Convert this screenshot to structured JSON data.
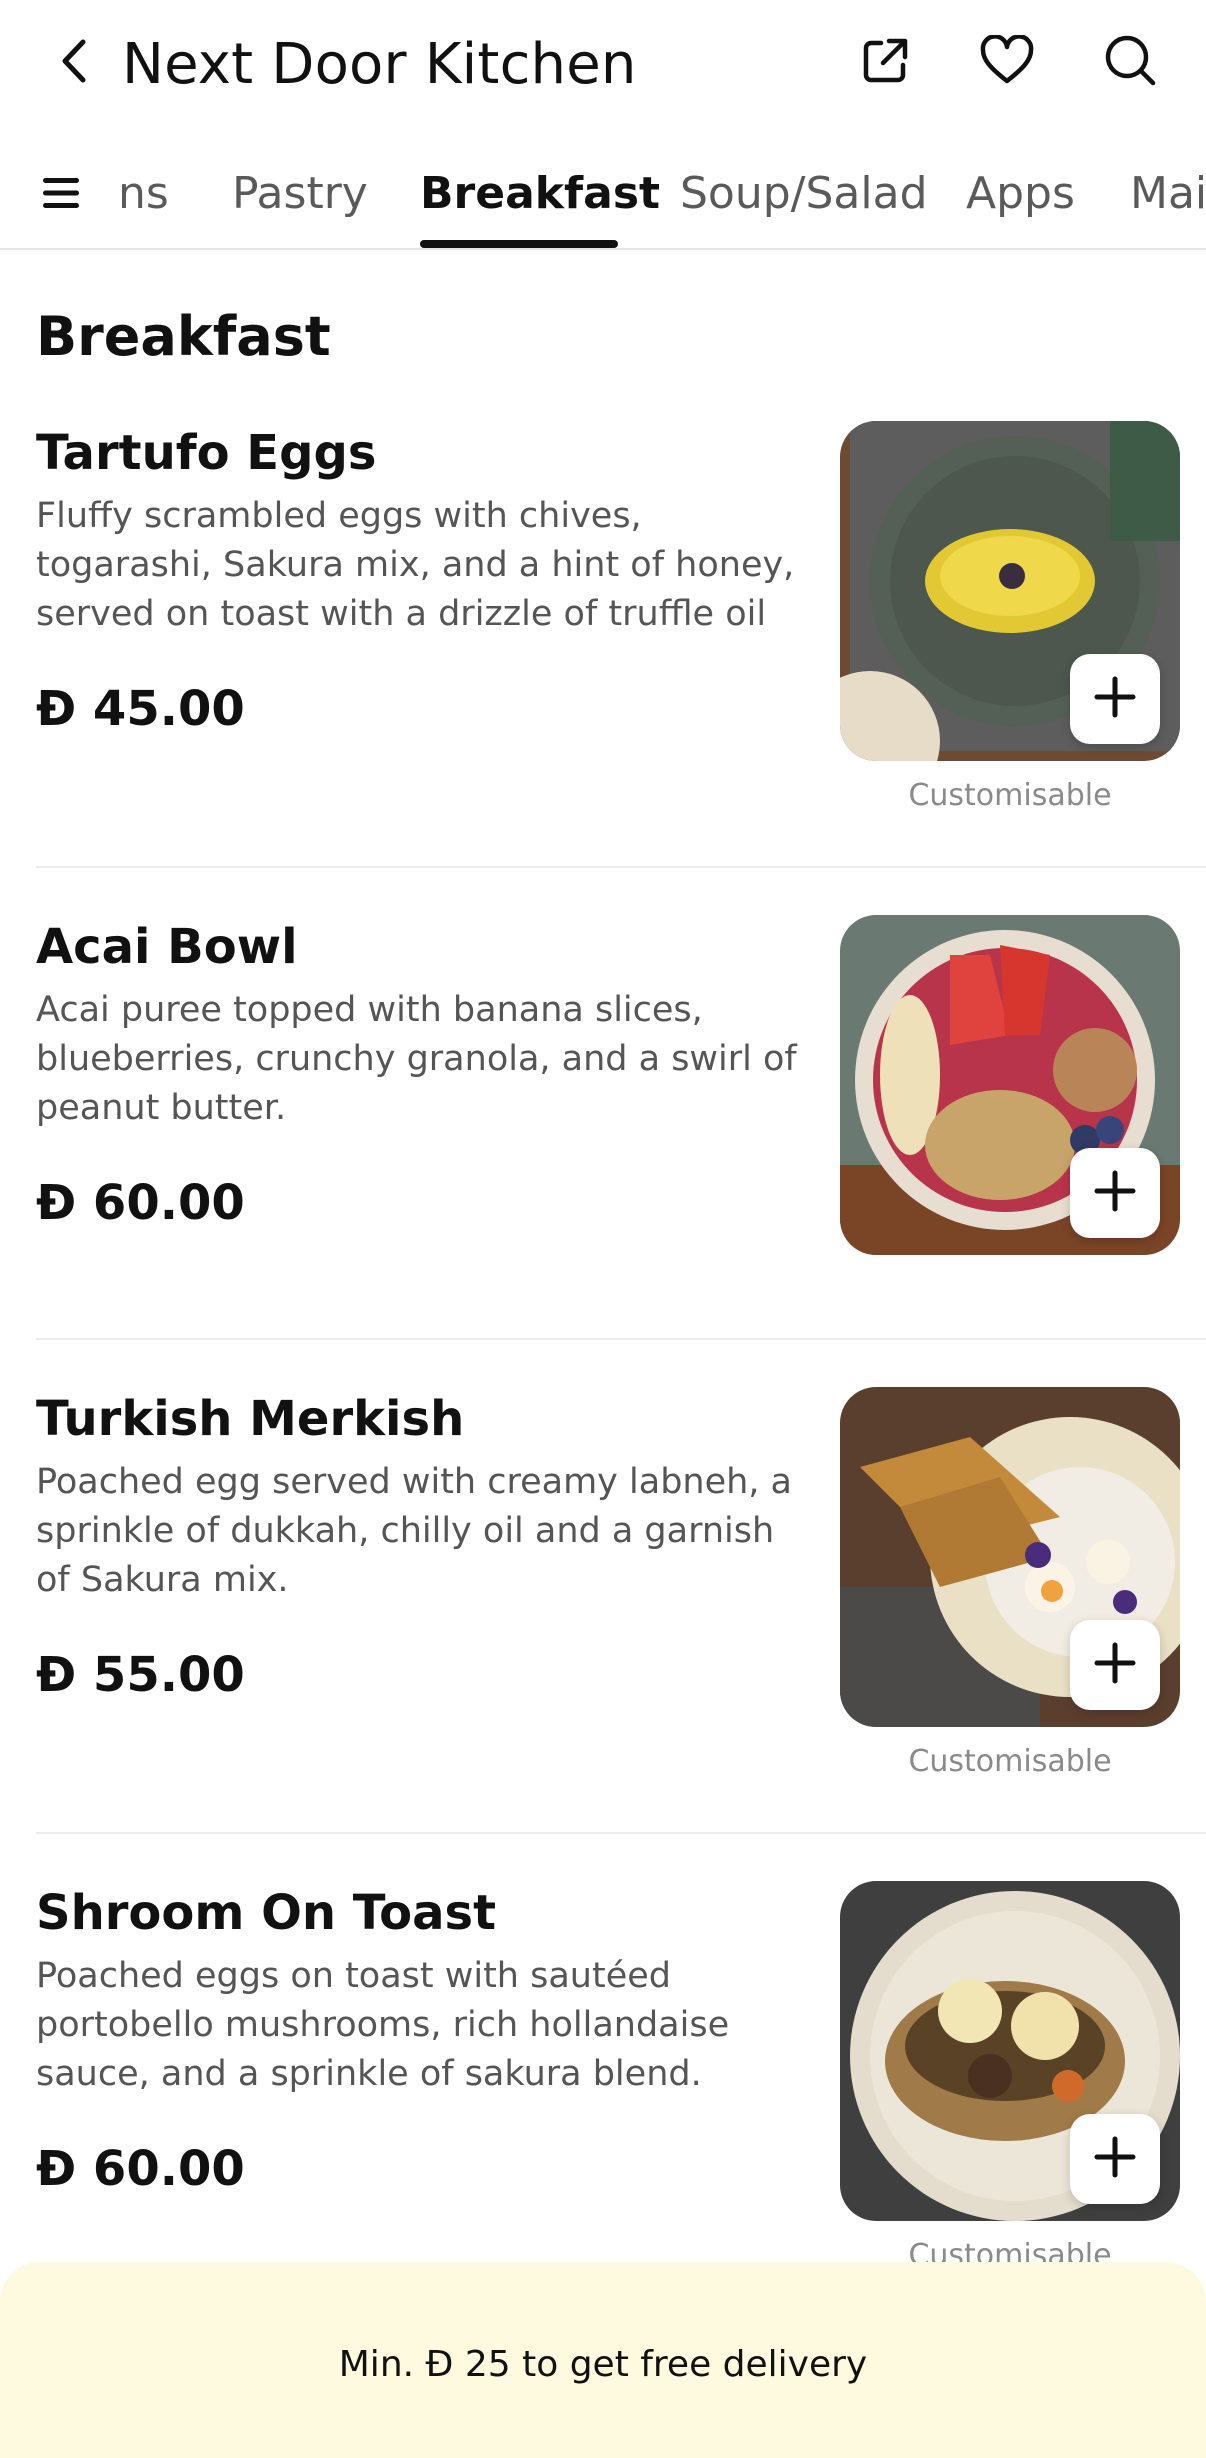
{
  "header": {
    "title": "Next Door Kitchen",
    "icons": [
      "back-arrow-icon",
      "share-icon",
      "heart-icon",
      "search-icon"
    ]
  },
  "tabs": [
    {
      "label": "ns"
    },
    {
      "label": "Pastry"
    },
    {
      "label": "Breakfast",
      "active": true
    },
    {
      "label": "Soup/Salad"
    },
    {
      "label": "Apps"
    },
    {
      "label": "Mai"
    }
  ],
  "section": {
    "title": "Breakfast"
  },
  "items": [
    {
      "name": "Tartufo Eggs",
      "description": "Fluffy scrambled eggs with chives, togarashi, Sakura mix, and a hint of honey, served on toast with a drizzle of truffle oil",
      "price": "Ð 45.00",
      "customisable": "Customisable"
    },
    {
      "name": "Acai Bowl",
      "description": "Acai puree topped with banana slices, blueberries, crunchy granola, and a swirl of peanut butter.",
      "price": "Ð 60.00",
      "customisable": ""
    },
    {
      "name": "Turkish Merkish",
      "description": "Poached egg served with creamy labneh, a sprinkle of dukkah, chilly oil and a garnish of Sakura mix.",
      "price": "Ð 55.00",
      "customisable": "Customisable"
    },
    {
      "name": "Shroom On Toast",
      "description": "Poached eggs on toast with sautéed portobello mushrooms, rich hollandaise sauce, and a sprinkle of sakura blend.",
      "price": "Ð 60.00",
      "customisable": "Customisable"
    }
  ],
  "footer": {
    "text": "Min. Ð 25 to get free delivery"
  },
  "colors": {
    "footer_bg": "#fdfae0",
    "accent": "#111111"
  }
}
